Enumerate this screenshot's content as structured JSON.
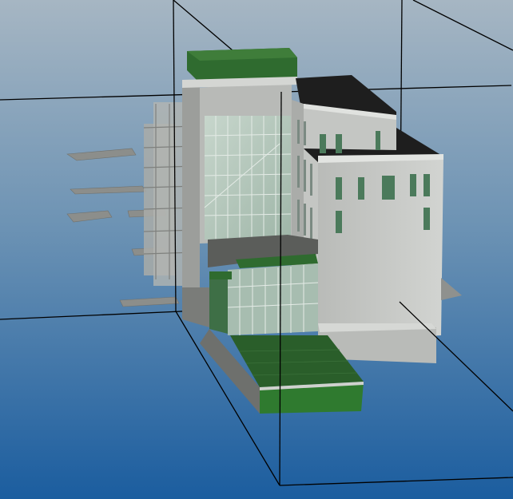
{
  "viewport": {
    "background_top": "#a4b5c2",
    "background_bottom": "#1e5fa0"
  },
  "model": {
    "roof_green": "#2e6b2e",
    "roof_dark": "#1d1d1d",
    "wall_light": "#c9cbc8",
    "wall_shade": "#9fa19e",
    "glass": "#b8cbc0",
    "window_green": "#4a7a5a",
    "section_box_edge": "#000000"
  }
}
